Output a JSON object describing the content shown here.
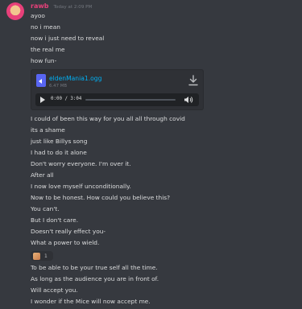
{
  "message": {
    "author": "rawb",
    "timestamp": "Today at 2:09 PM",
    "lines_before": [
      "ayoo",
      "no i mean",
      "now i just need to reveal",
      "the real me",
      "how fun-"
    ],
    "lines_after": [
      "I could of been this way for you all all through covid",
      "its a shame",
      "just like Billys song",
      "I had to do it alone",
      "Don't worry everyone. I'm over it.",
      "After all",
      "I now love myself unconditionally.",
      "Now to be honest. How could you believe this?",
      "You can't.",
      "But I don't care.",
      "Doesn't really effect you-",
      "What a power to wield."
    ],
    "lines_end": [
      "To be able to be your true self all the time.",
      "As long as the audience you are in front of.",
      "Will accept you.",
      "I wonder if the Mice will now accept me."
    ]
  },
  "attachment": {
    "file_name": "eldenMania1.ogg",
    "file_size": "6.47 MB",
    "time_display": "0:00 / 3:04",
    "progress": 0
  },
  "reaction": {
    "emoji_icon": "face-emoji-icon",
    "count": "1"
  },
  "colors": {
    "username": "#e8407a",
    "link": "#00b0f4",
    "background": "#36393f"
  }
}
